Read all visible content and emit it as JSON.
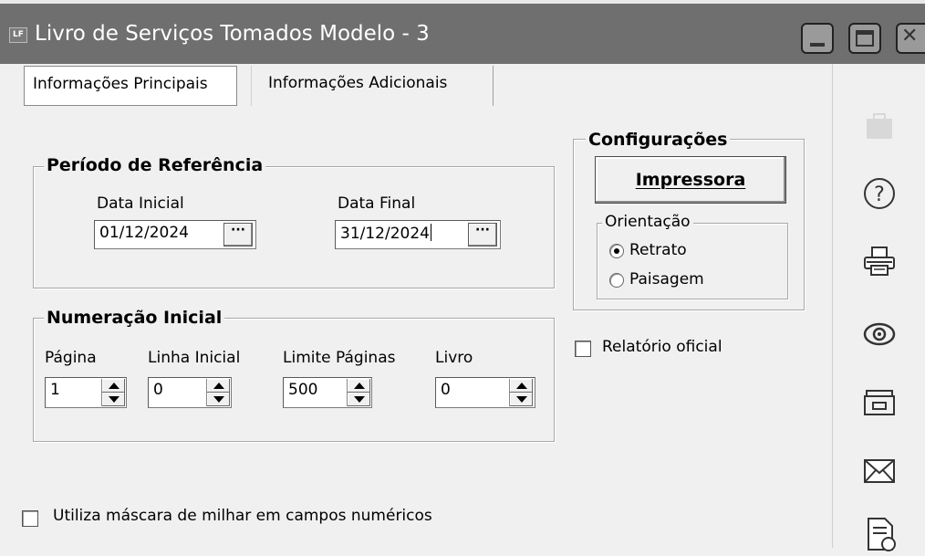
{
  "window": {
    "icon_text": "LF",
    "title": "Livro de Serviços Tomados Modelo - 3"
  },
  "tabs": [
    {
      "label": "Informações Principais",
      "active": true
    },
    {
      "label": "Informações Adicionais",
      "active": false
    }
  ],
  "periodo": {
    "legend": "Período de Referência",
    "data_inicial": {
      "label": "Data Inicial",
      "value": "01/12/2024",
      "button": "···"
    },
    "data_final": {
      "label": "Data Final",
      "value": "31/12/2024",
      "button": "···"
    }
  },
  "numeracao": {
    "legend": "Numeração Inicial",
    "fields": [
      {
        "label": "Página",
        "value": "1"
      },
      {
        "label": "Linha Inicial",
        "value": "0"
      },
      {
        "label": "Limite Páginas",
        "value": "500"
      },
      {
        "label": "Livro",
        "value": "0"
      }
    ]
  },
  "configuracoes": {
    "legend": "Configurações",
    "printer_button": "Impressora",
    "orientacao": {
      "legend": "Orientação",
      "options": [
        {
          "label": "Retrato",
          "selected": true
        },
        {
          "label": "Paisagem",
          "selected": false
        }
      ]
    }
  },
  "relatorio_oficial": {
    "label": "Relatório oficial",
    "checked": false
  },
  "mascara_milhar": {
    "label": "Utiliza máscara de milhar em campos numéricos",
    "checked": false
  },
  "toolbar_icons": [
    "briefcase-icon",
    "help-icon",
    "print-icon",
    "preview-icon",
    "export-icon",
    "email-icon",
    "document-icon"
  ],
  "colors": {
    "titlebar": "#6f6f6f",
    "window_bg": "#f0f0f0",
    "field_bg": "#ffffff"
  }
}
